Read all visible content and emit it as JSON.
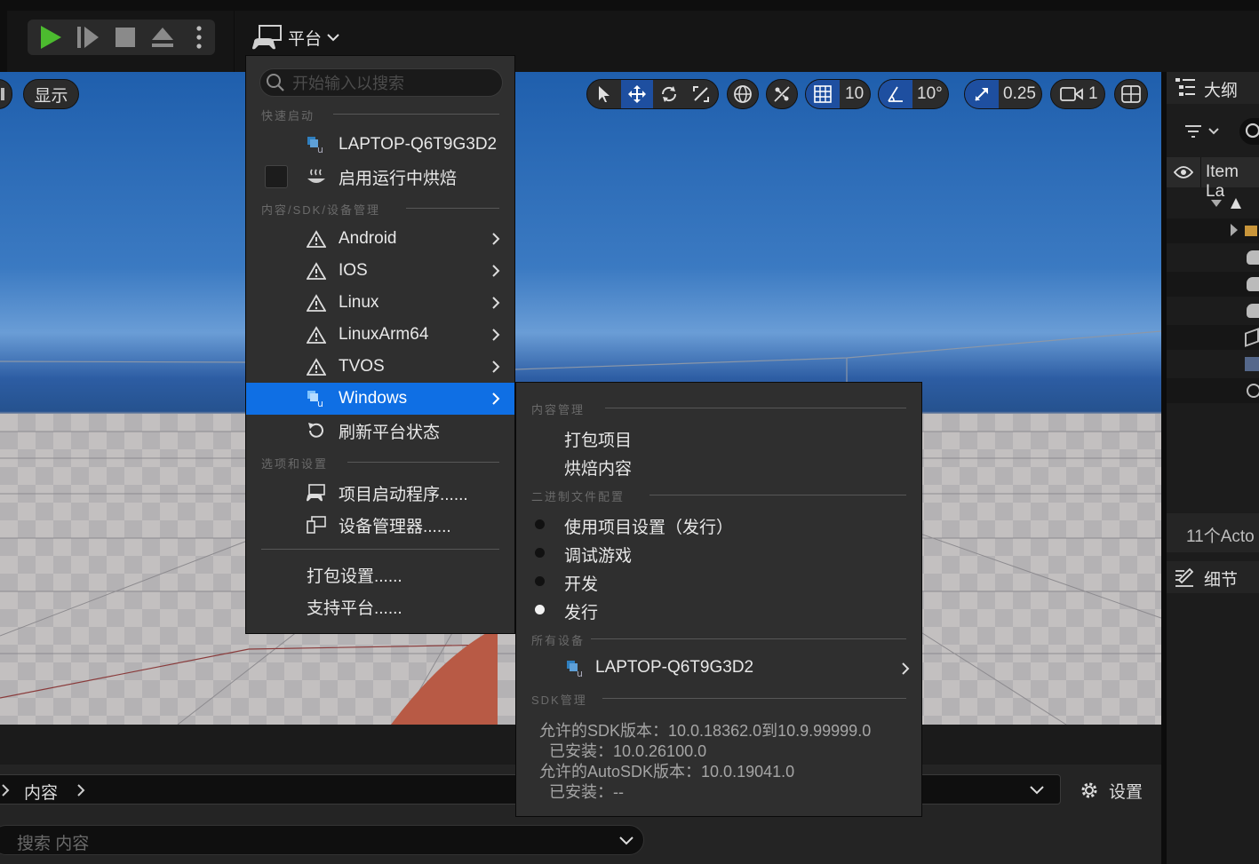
{
  "toolbar": {
    "platform_label": "平台",
    "icons": [
      "play-icon",
      "play-next-frame-icon",
      "stop-icon",
      "eject-icon",
      "more-icon",
      "platform-icon",
      "chevron-down-icon"
    ],
    "colors": {
      "play_green": "#4cbb2f"
    }
  },
  "viewport": {
    "left_button": "显示",
    "grid_snap": "10",
    "rotation_snap": "10°",
    "scale_snap": "0.25",
    "camera_speed": "1",
    "colors": {
      "active_tool": "#1e4fa0"
    }
  },
  "outliner": {
    "title": "大纲",
    "column_label": "Item La",
    "actor_count": "11个Acto",
    "details_title": "细节"
  },
  "content_browser": {
    "breadcrumb_label": "内容",
    "settings_label": "设置",
    "search_placeholder": "搜索 内容"
  },
  "platform_menu": {
    "search_placeholder": "开始输入以搜索",
    "section_quick_launch": "快速启动",
    "quick_launch_device": "LAPTOP-Q6T9G3D2",
    "enable_cook_on_fly": "启用运行中烘焙",
    "section_sdk": "内容/SDK/设备管理",
    "platforms": [
      "Android",
      "IOS",
      "Linux",
      "LinuxArm64",
      "TVOS"
    ],
    "windows_label": "Windows",
    "refresh_label": "刷新平台状态",
    "section_options": "选项和设置",
    "project_launcher": "项目启动程序......",
    "device_manager": "设备管理器......",
    "packaging_settings": "打包设置......",
    "supported_platforms": "支持平台......",
    "colors": {
      "highlight": "#0f6fe4"
    }
  },
  "windows_submenu": {
    "section_content": "内容管理",
    "package_project": "打包项目",
    "cook_content": "烘焙内容",
    "section_binary": "二进制文件配置",
    "binary_options": [
      "使用项目设置（发行）",
      "调试游戏",
      "开发",
      "发行"
    ],
    "selected_binary": "发行",
    "section_devices": "所有设备",
    "device_name": "LAPTOP-Q6T9G3D2",
    "section_sdk": "SDK管理",
    "sdk_allowed": "允许的SDK版本：10.0.18362.0到10.9.99999.0",
    "sdk_installed": "已安装：10.0.26100.0",
    "autosdk_allowed": "允许的AutoSDK版本：10.0.19041.0",
    "autosdk_installed": "已安装：--"
  }
}
